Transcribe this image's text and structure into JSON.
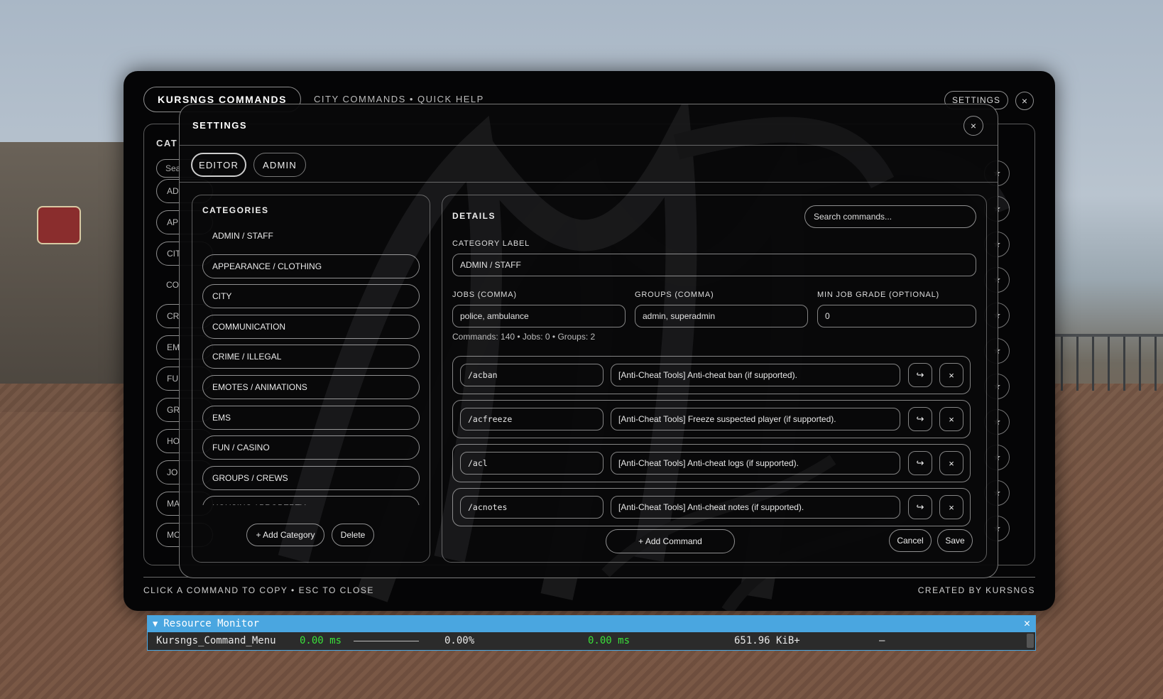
{
  "main": {
    "title": "KURSNGS COMMANDS",
    "subtitle": "CITY COMMANDS • QUICK HELP",
    "settings_label": "SETTINGS",
    "close_glyph": "×",
    "bg_categories_title": "CAT",
    "bg_search_placeholder": "Sea",
    "bg_categories": [
      "AD",
      "AP",
      "CIT",
      "CO",
      "CR",
      "EM",
      "FU",
      "GR",
      "HO",
      "JO",
      "MA",
      "MO"
    ],
    "star_glyph": "★",
    "footer_left": "CLICK A COMMAND TO COPY • ESC TO CLOSE",
    "footer_right": "CREATED BY KURSNGS"
  },
  "settings": {
    "title": "SETTINGS",
    "close_glyph": "×",
    "tabs": [
      {
        "label": "EDITOR",
        "active": true
      },
      {
        "label": "ADMIN",
        "active": false
      }
    ],
    "categories": {
      "title": "CATEGORIES",
      "items": [
        "ADMIN / STAFF",
        "APPEARANCE / CLOTHING",
        "CITY",
        "COMMUNICATION",
        "CRIME / ILLEGAL",
        "EMOTES / ANIMATIONS",
        "EMS",
        "FUN / CASINO",
        "GROUPS / CREWS",
        "HOUSING / PROPERTY"
      ],
      "active_index": 0,
      "add_label": "+ Add Category",
      "delete_label": "Delete"
    },
    "details": {
      "title": "DETAILS",
      "search_placeholder": "Search commands...",
      "category_label_title": "CATEGORY LABEL",
      "category_label_value": "ADMIN / STAFF",
      "jobs_title": "JOBS (COMMA)",
      "jobs_value": "police, ambulance",
      "groups_title": "GROUPS (COMMA)",
      "groups_value": "admin, superadmin",
      "min_grade_title": "MIN JOB GRADE (OPTIONAL)",
      "min_grade_value": "0",
      "stats": "Commands: 140 • Jobs: 0 • Groups: 2",
      "commands": [
        {
          "name": "/acban",
          "description": "[Anti-Cheat Tools] Anti-cheat ban (if supported)."
        },
        {
          "name": "/acfreeze",
          "description": "[Anti-Cheat Tools] Freeze suspected player (if supported)."
        },
        {
          "name": "/acl",
          "description": "[Anti-Cheat Tools] Anti-cheat logs (if supported)."
        },
        {
          "name": "/acnotes",
          "description": "[Anti-Cheat Tools] Anti-cheat notes (if supported)."
        }
      ],
      "move_glyph": "↪",
      "delete_glyph": "×",
      "add_command_label": "+ Add Command",
      "cancel_label": "Cancel",
      "save_label": "Save"
    }
  },
  "resource_monitor": {
    "title": "Resource Monitor",
    "collapse_glyph": "▼",
    "close_glyph": "✕",
    "row": {
      "name": "Kursngs_Command_Menu",
      "cpu_ms": "0.00 ms",
      "percent": "0.00%",
      "time_ms": "0.00 ms",
      "memory": "651.96 KiB+",
      "extra": "–"
    },
    "accent_color": "#4aa6e0"
  }
}
